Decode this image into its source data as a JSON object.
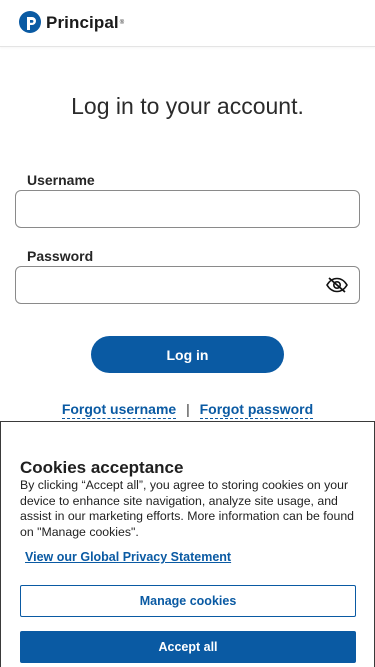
{
  "header": {
    "brand_name": "Principal",
    "brand_mark": "®",
    "logo_color": "#0a5aa3"
  },
  "main": {
    "title": "Log in to your account.",
    "username_label": "Username",
    "username_value": "",
    "password_label": "Password",
    "password_value": "",
    "password_toggle_icon": "eye-slash-icon",
    "login_label": "Log in",
    "forgot_username": "Forgot username",
    "separator": "|",
    "forgot_password": "Forgot password"
  },
  "cookies": {
    "title": "Cookies acceptance",
    "body": "By clicking “Accept all”, you agree to storing cookies on your device to enhance site navigation, analyze site usage, and assist in our marketing efforts. More information can be found on \"Manage cookies\".",
    "privacy_link": "View our Global Privacy Statement",
    "manage_label": "Manage cookies",
    "accept_label": "Accept all"
  },
  "colors": {
    "accent": "#0a5aa3",
    "text": "#1f1f1f",
    "border": "#8a8a8a"
  }
}
